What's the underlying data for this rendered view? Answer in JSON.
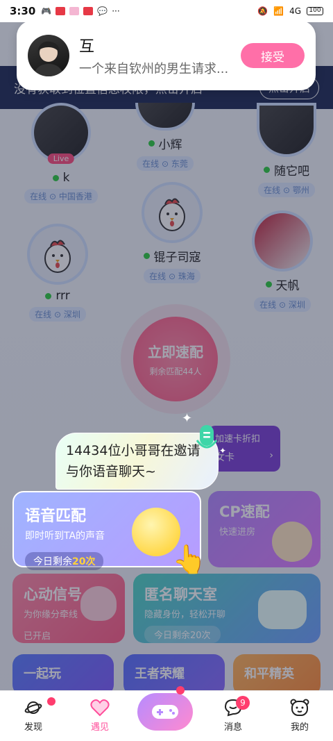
{
  "status_bar": {
    "time": "3:30",
    "signal": "4G",
    "battery": "100"
  },
  "notification": {
    "title": "互",
    "message": "一个来自钦州的男生请求...",
    "accept_label": "接受"
  },
  "location_banner": {
    "text": "没有获取到位置信息权限，点击开启",
    "button": "点击开启"
  },
  "users": [
    {
      "name": "k",
      "location": "在线 ⊙ 中国香港",
      "live": "Live"
    },
    {
      "name": "小辉",
      "location": "在线 ⊙ 东莞"
    },
    {
      "name": "随它吧",
      "location": "在线 ⊙ 鄂州"
    },
    {
      "name": "锟子司寇",
      "location": "在线 ⊙ 珠海"
    },
    {
      "name": "rrr",
      "location": "在线 ⊙ 深圳"
    },
    {
      "name": "天帆",
      "location": "在线 ⊙ 深圳"
    }
  ],
  "speed_match": {
    "title": "立即速配",
    "remaining": "剩余匹配44人"
  },
  "promo": {
    "line1": "加速卡折扣",
    "line2": "女卡"
  },
  "guide_bubble": {
    "text": "14434位小哥哥在邀请与你语音聊天~"
  },
  "voice_match": {
    "title": "语音匹配",
    "subtitle": "即时听到TA的声音",
    "remaining_prefix": "今日剩余",
    "remaining_count": "20次"
  },
  "cards": {
    "cp": {
      "title": "CP速配",
      "subtitle": "快速进房"
    },
    "heart": {
      "title": "心动信号",
      "subtitle": "为你缘分牵线",
      "status": "已开启"
    },
    "anon": {
      "title": "匿名聊天室",
      "subtitle": "隐藏身份，轻松开聊",
      "remaining": "今日剩余20次"
    },
    "play": {
      "title": "一起玩"
    },
    "wzry": {
      "title": "王者荣耀"
    },
    "hpjy": {
      "title": "和平精英"
    }
  },
  "nav": {
    "discover": "发现",
    "meet": "遇见",
    "messages": "消息",
    "messages_badge": "9",
    "me": "我的"
  },
  "colors": {
    "accent": "#ff4d9a",
    "accept": "#ff6fa8",
    "banner": "#1e2a55"
  }
}
